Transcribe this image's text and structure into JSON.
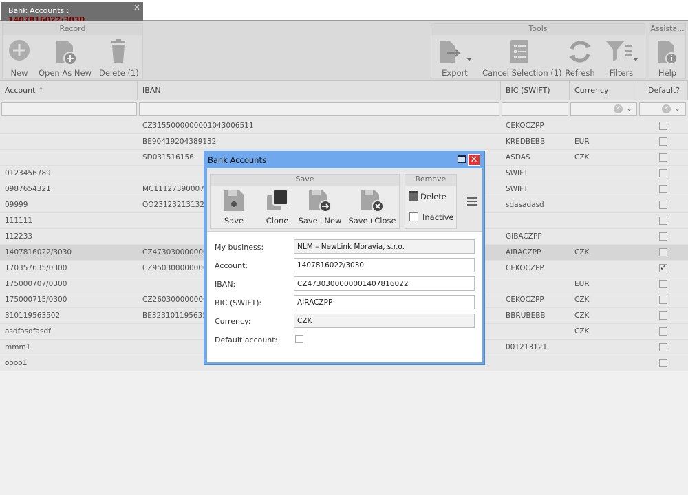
{
  "tab": {
    "label": "Bank Accounts : ",
    "account": "1407816022/3030",
    "close": "✕"
  },
  "ribbon": {
    "record": {
      "title": "Record",
      "new": "New",
      "open_as_new": "Open As New",
      "delete": "Delete (1)"
    },
    "tools": {
      "title": "Tools",
      "export": "Export",
      "cancel_selection": "Cancel Selection (1)",
      "refresh": "Refresh",
      "filters": "Filters"
    },
    "assist": {
      "title": "Assista...",
      "help": "Help"
    }
  },
  "grid": {
    "headers": {
      "account": "Account",
      "iban": "IBAN",
      "bic": "BIC (SWIFT)",
      "currency": "Currency",
      "default": "Default?"
    },
    "rows": [
      {
        "account": "",
        "iban": "CZ3155000000001043006511",
        "bic": "CEKOCZPP",
        "currency": "",
        "default": false
      },
      {
        "account": "",
        "iban": "BE90419204389132",
        "bic": "KREDBEBB",
        "currency": "EUR",
        "default": false
      },
      {
        "account": "",
        "iban": "SD031516156",
        "bic": "ASDAS",
        "currency": "CZK",
        "default": false
      },
      {
        "account": "0123456789",
        "iban": "",
        "bic": "SWIFT",
        "currency": "",
        "default": false
      },
      {
        "account": "0987654321",
        "iban": "MC111273900070",
        "bic": "SWIFT",
        "currency": "",
        "default": false
      },
      {
        "account": "09999",
        "iban": "OO231232131321",
        "bic": "sdasadasd",
        "currency": "",
        "default": false
      },
      {
        "account": "111111",
        "iban": "",
        "bic": "",
        "currency": "",
        "default": false
      },
      {
        "account": "112233",
        "iban": "",
        "bic": "GIBACZPP",
        "currency": "",
        "default": false
      },
      {
        "account": "1407816022/3030",
        "iban": "CZ4730300000001",
        "bic": "AIRACZPP",
        "currency": "CZK",
        "default": false
      },
      {
        "account": "170357635/0300",
        "iban": "CZ9503000000000",
        "bic": "CEKOCZPP",
        "currency": "",
        "default": true
      },
      {
        "account": "175000707/0300",
        "iban": "",
        "bic": "",
        "currency": "EUR",
        "default": false
      },
      {
        "account": "175000715/0300",
        "iban": "CZ2603000000000",
        "bic": "CEKOCZPP",
        "currency": "CZK",
        "default": false
      },
      {
        "account": "310119563502",
        "iban": "BE3231011956350",
        "bic": "BBRUBEBB",
        "currency": "CZK",
        "default": false
      },
      {
        "account": "asdfasdfasdf",
        "iban": "",
        "bic": "",
        "currency": "CZK",
        "default": false
      },
      {
        "account": "mmm1",
        "iban": "",
        "bic": "001213121",
        "currency": "",
        "default": false
      },
      {
        "account": "oooo1",
        "iban": "",
        "bic": "",
        "currency": "",
        "default": false
      }
    ]
  },
  "dialog": {
    "title": "Bank Accounts",
    "save_group": {
      "title": "Save",
      "save": "Save",
      "clone": "Clone",
      "save_new": "Save+New",
      "save_close": "Save+Close"
    },
    "remove_group": {
      "title": "Remove",
      "delete": "Delete",
      "inactive": "Inactive"
    },
    "fields": {
      "my_business": {
        "label": "My business:",
        "value": "NLM – NewLink Moravia, s.r.o."
      },
      "account": {
        "label": "Account:",
        "value": "1407816022/3030"
      },
      "iban": {
        "label": "IBAN:",
        "value": "CZ4730300000001407816022"
      },
      "bic": {
        "label": "BIC (SWIFT):",
        "value": "AIRACZPP"
      },
      "currency": {
        "label": "Currency:",
        "value": "CZK"
      },
      "default_account": {
        "label": "Default account:",
        "checked": false
      }
    }
  }
}
